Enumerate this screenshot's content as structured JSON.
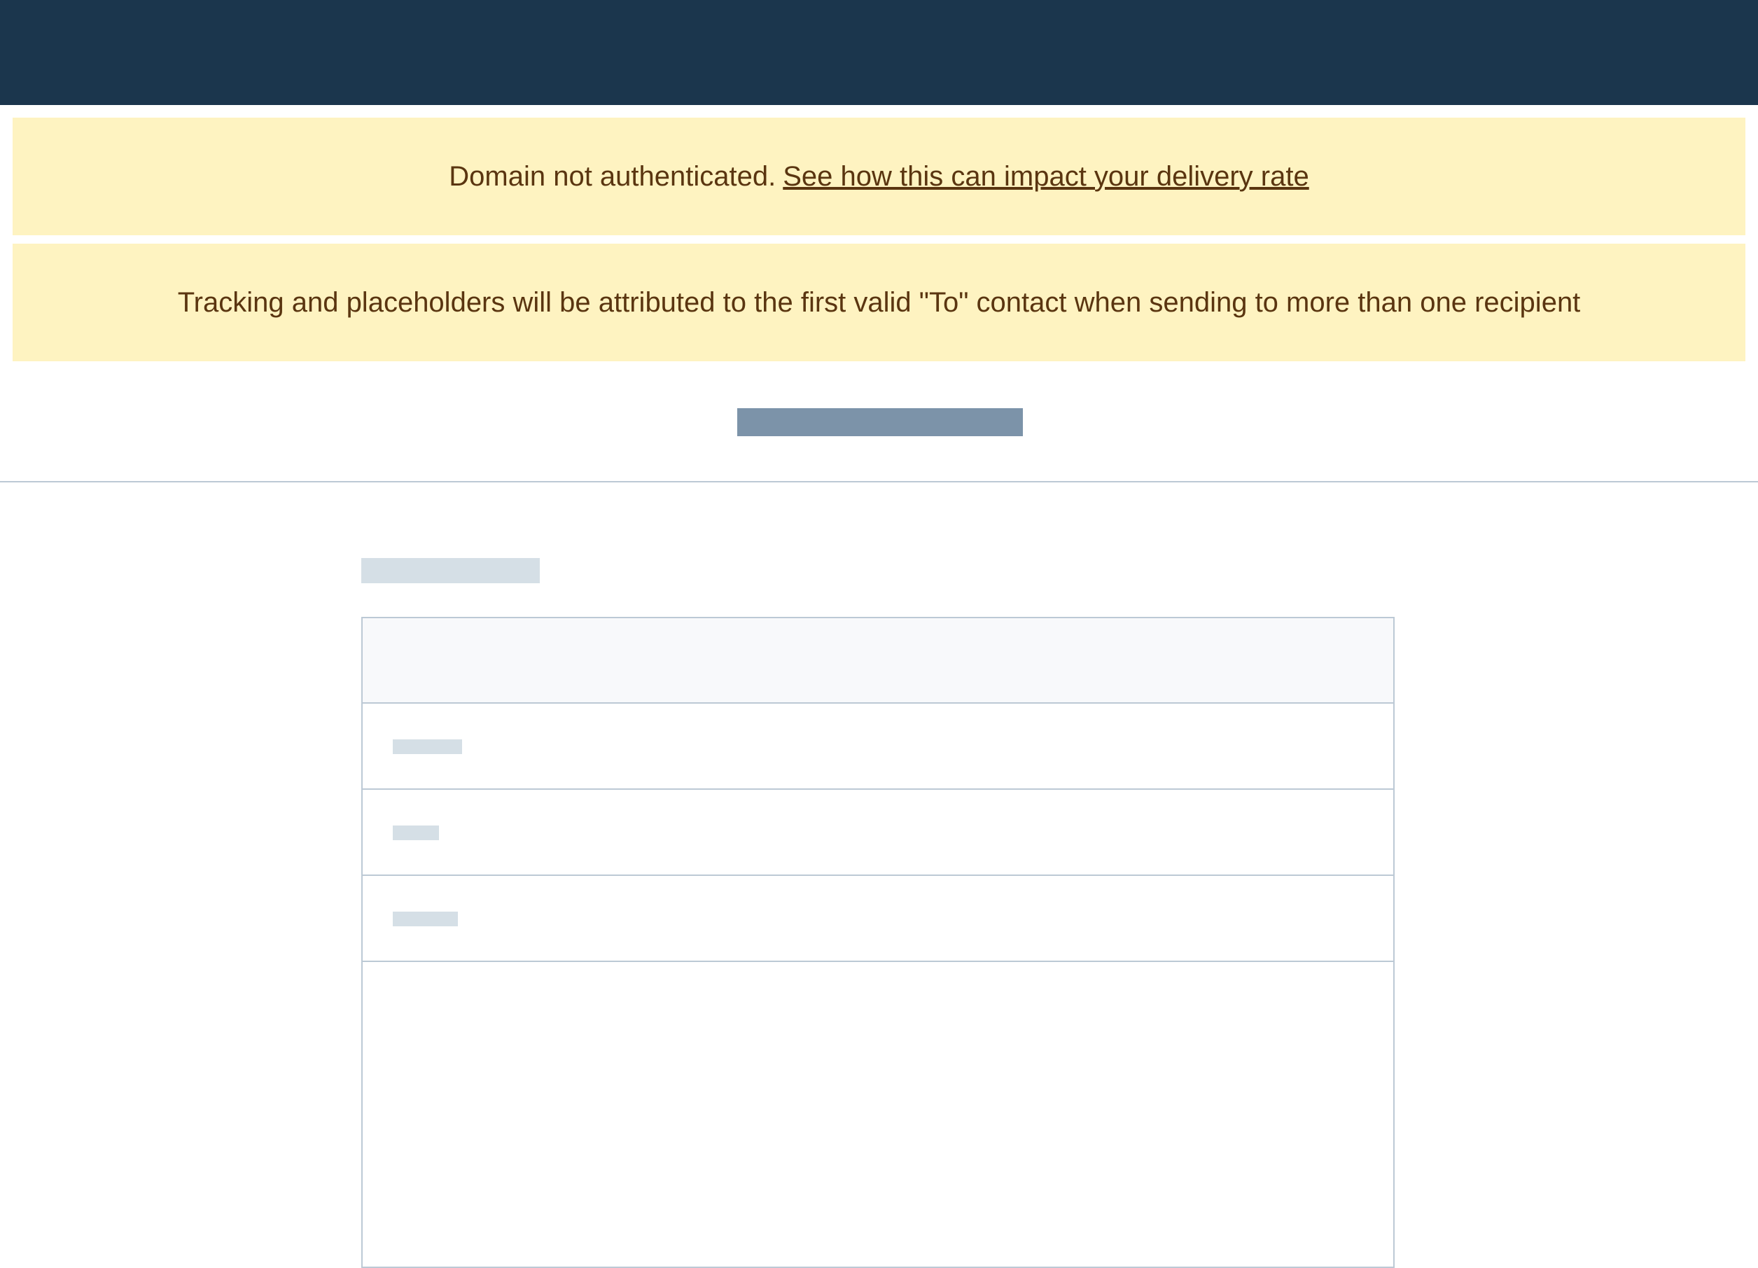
{
  "app": {
    "top_nav": {}
  },
  "banners": {
    "domain_warning": {
      "text": "Domain not authenticated.",
      "link_label": "See how this can impact your delivery rate"
    },
    "tracking_notice": {
      "text": "Tracking and placeholders will be attributed to the first valid \"To\" contact when sending to more than one recipient"
    }
  },
  "colors": {
    "topbar": "#1b364d",
    "banner_background": "#fef3c1",
    "banner_text": "#5a3510",
    "skeleton_dark": "#7c93a9",
    "skeleton_light": "#d5dfe6",
    "border": "#bcc9d5"
  }
}
